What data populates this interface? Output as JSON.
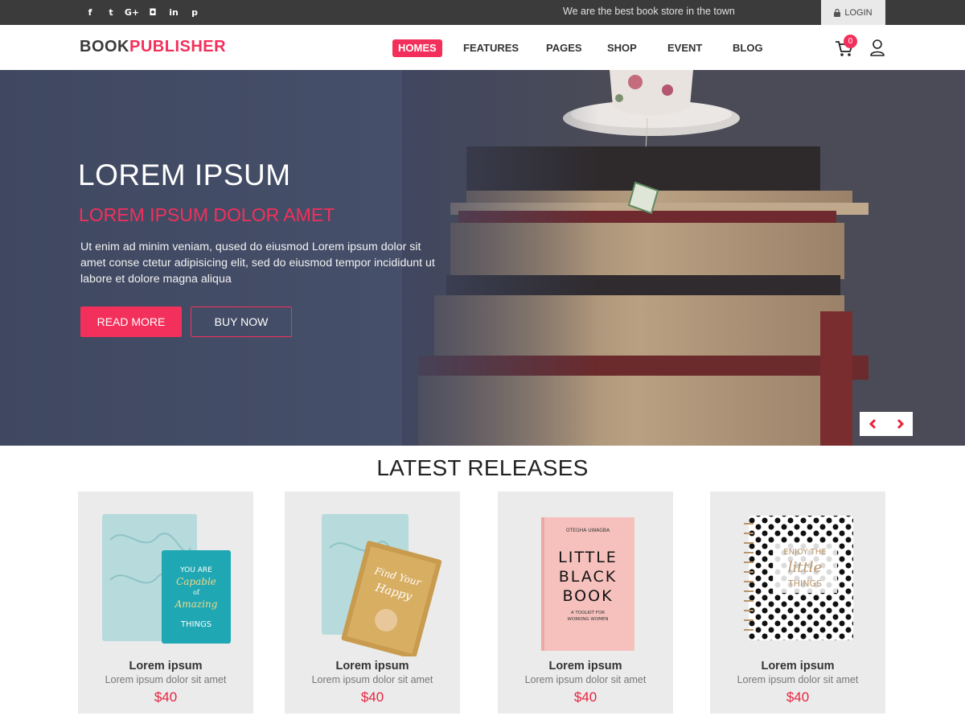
{
  "topbar": {
    "social": [
      {
        "icon": "facebook-icon",
        "glyph": "f"
      },
      {
        "icon": "twitter-icon",
        "glyph": "t"
      },
      {
        "icon": "google-plus-icon",
        "glyph": "G+"
      },
      {
        "icon": "instagram-icon",
        "glyph": "◘"
      },
      {
        "icon": "linkedin-icon",
        "glyph": "in"
      },
      {
        "icon": "pinterest-icon",
        "glyph": "p"
      }
    ],
    "tagline": "We are the best book store in the town",
    "login_label": "LOGIN"
  },
  "header": {
    "logo_part1": "BOOK",
    "logo_part2": "PUBLISHER",
    "nav": [
      "HOMES",
      "FEATURES",
      "PAGES",
      "SHOP",
      "EVENT",
      "BLOG"
    ],
    "active_nav": "HOMES",
    "cart_count": "0"
  },
  "hero": {
    "title": "LOREM IPSUM",
    "subtitle": "LOREM IPSUM DOLOR AMET",
    "text": "Ut enim ad minim veniam, qused do eiusmod  Lorem ipsum dolor sit amet conse ctetur adipisicing elit, sed do eiusmod tempor incididunt ut labore et dolore magna aliqua",
    "read_more": "READ MORE",
    "buy_now": "BUY NOW"
  },
  "releases": {
    "title": "LATEST RELEASES",
    "items": [
      {
        "name": "Lorem ipsum",
        "desc": "Lorem ipsum dolor sit amet",
        "price": "$40",
        "cover_text": "YOU ARE Capable of Amazing THINGS"
      },
      {
        "name": "Lorem ipsum",
        "desc": "Lorem ipsum dolor sit amet",
        "price": "$40",
        "cover_text": "Find Your Happy"
      },
      {
        "name": "Lorem ipsum",
        "desc": "Lorem ipsum dolor sit amet",
        "price": "$40",
        "cover_author": "OTEGHA UWAGBA",
        "cover_title": "LITTLE BLACK BOOK",
        "cover_sub": "A TOOLKIT FOR WORKING WOMEN"
      },
      {
        "name": "Lorem ipsum",
        "desc": "Lorem ipsum dolor sit amet",
        "price": "$40",
        "cover_text": "ENJOY THE little THINGS"
      }
    ]
  },
  "colors": {
    "accent": "#f3305b",
    "topbar": "#3b3b3b",
    "hero_overlay": "#444c64",
    "price": "#e8243f"
  }
}
